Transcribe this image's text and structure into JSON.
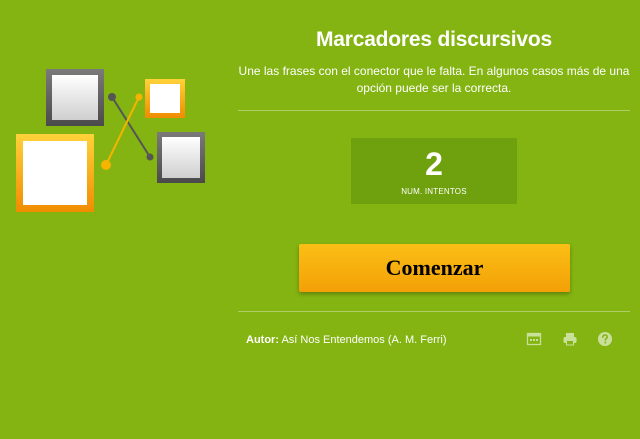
{
  "header": {
    "title": "Marcadores discursivos",
    "subtitle": "Une las frases con el conector que le falta. En algunos casos más de una opción puede ser la correcta."
  },
  "attempts": {
    "value": "2",
    "label": "NUM. INTENTOS"
  },
  "start_button": {
    "label": "Comenzar"
  },
  "footer": {
    "author_label": "Autor:",
    "author_name": "Así Nos Entendemos (A. M. Ferri)",
    "icons": [
      "calendar-icon",
      "print-icon",
      "help-icon"
    ]
  },
  "colors": {
    "background": "#84b412",
    "attempts_box": "#6fa00e",
    "button": "#f7b00c",
    "accent_orange": "#f6a40a",
    "frame_gray": "#5f5f5f"
  }
}
